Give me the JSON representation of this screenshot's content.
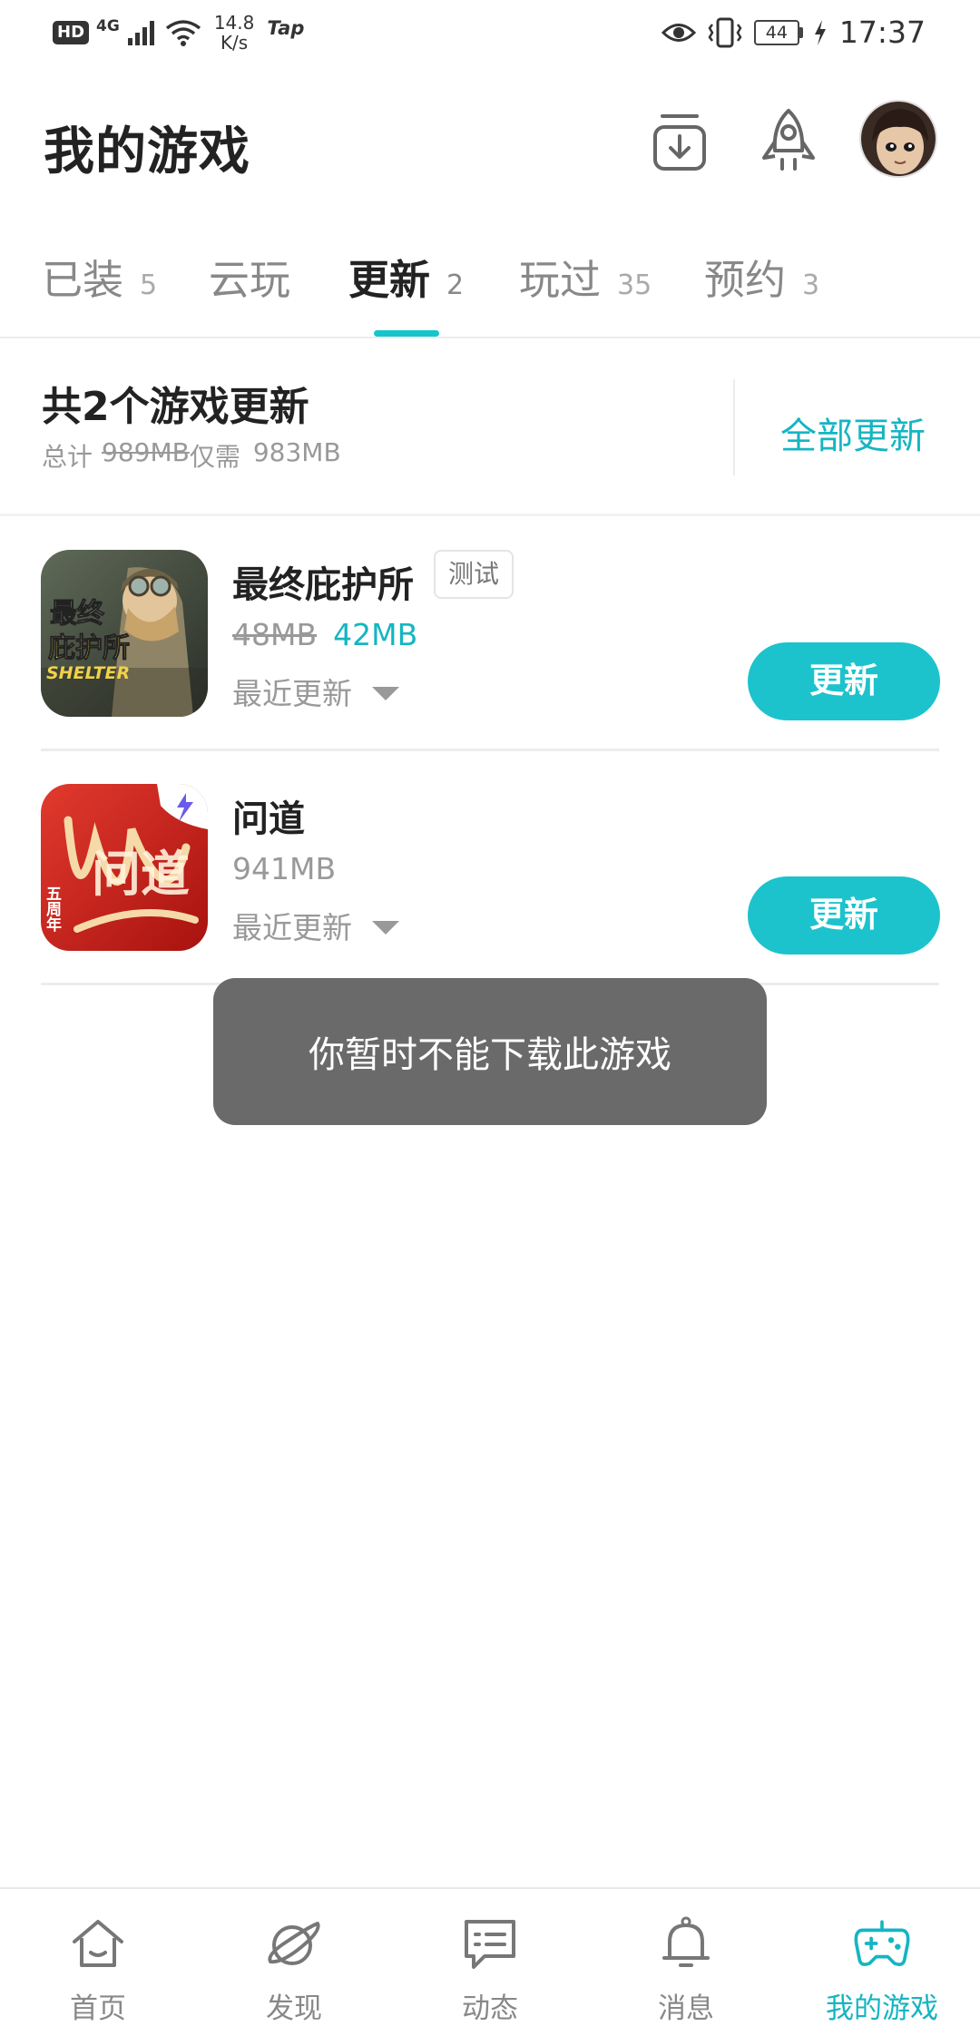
{
  "status_bar": {
    "hd": "HD",
    "network": "4G",
    "speed_value": "14.8",
    "speed_unit": "K/s",
    "tap": "Tap",
    "battery": "44",
    "time": "17:37"
  },
  "header": {
    "title": "我的游戏"
  },
  "tabs": [
    {
      "label": "已装",
      "count": "5"
    },
    {
      "label": "云玩",
      "count": ""
    },
    {
      "label": "更新",
      "count": "2"
    },
    {
      "label": "玩过",
      "count": "35"
    },
    {
      "label": "预约",
      "count": "3"
    }
  ],
  "summary": {
    "title": "共2个游戏更新",
    "total_prefix": "总计",
    "total_old": "989MB",
    "total_mid": "仅需",
    "total_new": "983MB",
    "update_all": "全部更新"
  },
  "games": [
    {
      "name": "最终庇护所",
      "badge": "测试",
      "old_size": "48MB",
      "new_size": "42MB",
      "recent": "最近更新",
      "button": "更新",
      "icon_text_1": "最终",
      "icon_text_2": "庇护所",
      "icon_text_3": "SHELTER"
    },
    {
      "name": "问道",
      "size": "941MB",
      "recent": "最近更新",
      "button": "更新",
      "icon_text_1": "问道",
      "icon_text_2": "五周年"
    }
  ],
  "toast": "你暂时不能下载此游戏",
  "bottom_nav": [
    {
      "label": "首页"
    },
    {
      "label": "发现"
    },
    {
      "label": "动态"
    },
    {
      "label": "消息"
    },
    {
      "label": "我的游戏"
    }
  ],
  "colors": {
    "accent": "#1cc3cc",
    "accent_text": "#15b5c2"
  }
}
